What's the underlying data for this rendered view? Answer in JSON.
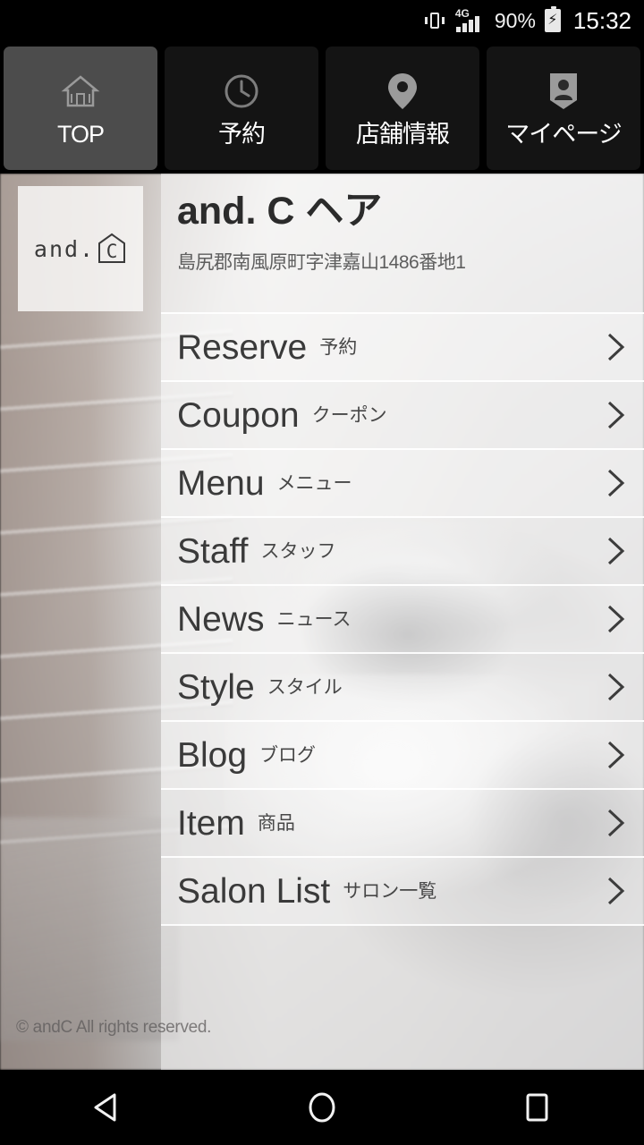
{
  "status_bar": {
    "vibrate_icon": "vibrate-icon",
    "network_type": "4G",
    "signal_icon": "signal-bars-icon",
    "battery_percent": "90%",
    "battery_icon": "battery-charging-icon",
    "clock": "15:32"
  },
  "tab_bar": {
    "tabs": [
      {
        "label": "TOP",
        "icon": "home-icon",
        "active": true
      },
      {
        "label": "予約",
        "icon": "clock-icon",
        "active": false
      },
      {
        "label": "店舗情報",
        "icon": "location-pin-icon",
        "active": false
      },
      {
        "label": "マイページ",
        "icon": "contact-card-icon",
        "active": false
      }
    ]
  },
  "logo": {
    "text": "and.",
    "mark_letter": "C",
    "shape": "house-outline-icon"
  },
  "header": {
    "salon_name": "and. C ヘア",
    "address": "島尻郡南風原町字津嘉山1486番地1"
  },
  "menu": {
    "items": [
      {
        "en": "Reserve",
        "ja": "予約"
      },
      {
        "en": "Coupon",
        "ja": "クーポン"
      },
      {
        "en": "Menu",
        "ja": "メニュー"
      },
      {
        "en": "Staff",
        "ja": "スタッフ"
      },
      {
        "en": "News",
        "ja": "ニュース"
      },
      {
        "en": "Style",
        "ja": "スタイル"
      },
      {
        "en": "Blog",
        "ja": "ブログ"
      },
      {
        "en": "Item",
        "ja": "商品"
      },
      {
        "en": "Salon List",
        "ja": "サロン一覧"
      }
    ],
    "chevron_icon": "chevron-right-icon"
  },
  "footer": {
    "copyright": "© andC All rights reserved."
  },
  "nav_bar": {
    "back": "back-triangle-icon",
    "home": "home-circle-icon",
    "recents": "recents-square-icon"
  },
  "colors": {
    "tab_active_bg": "#4c4c4c",
    "tab_inactive_bg": "#141414",
    "text_dark": "#3a3a3a",
    "system_black": "#000000"
  }
}
